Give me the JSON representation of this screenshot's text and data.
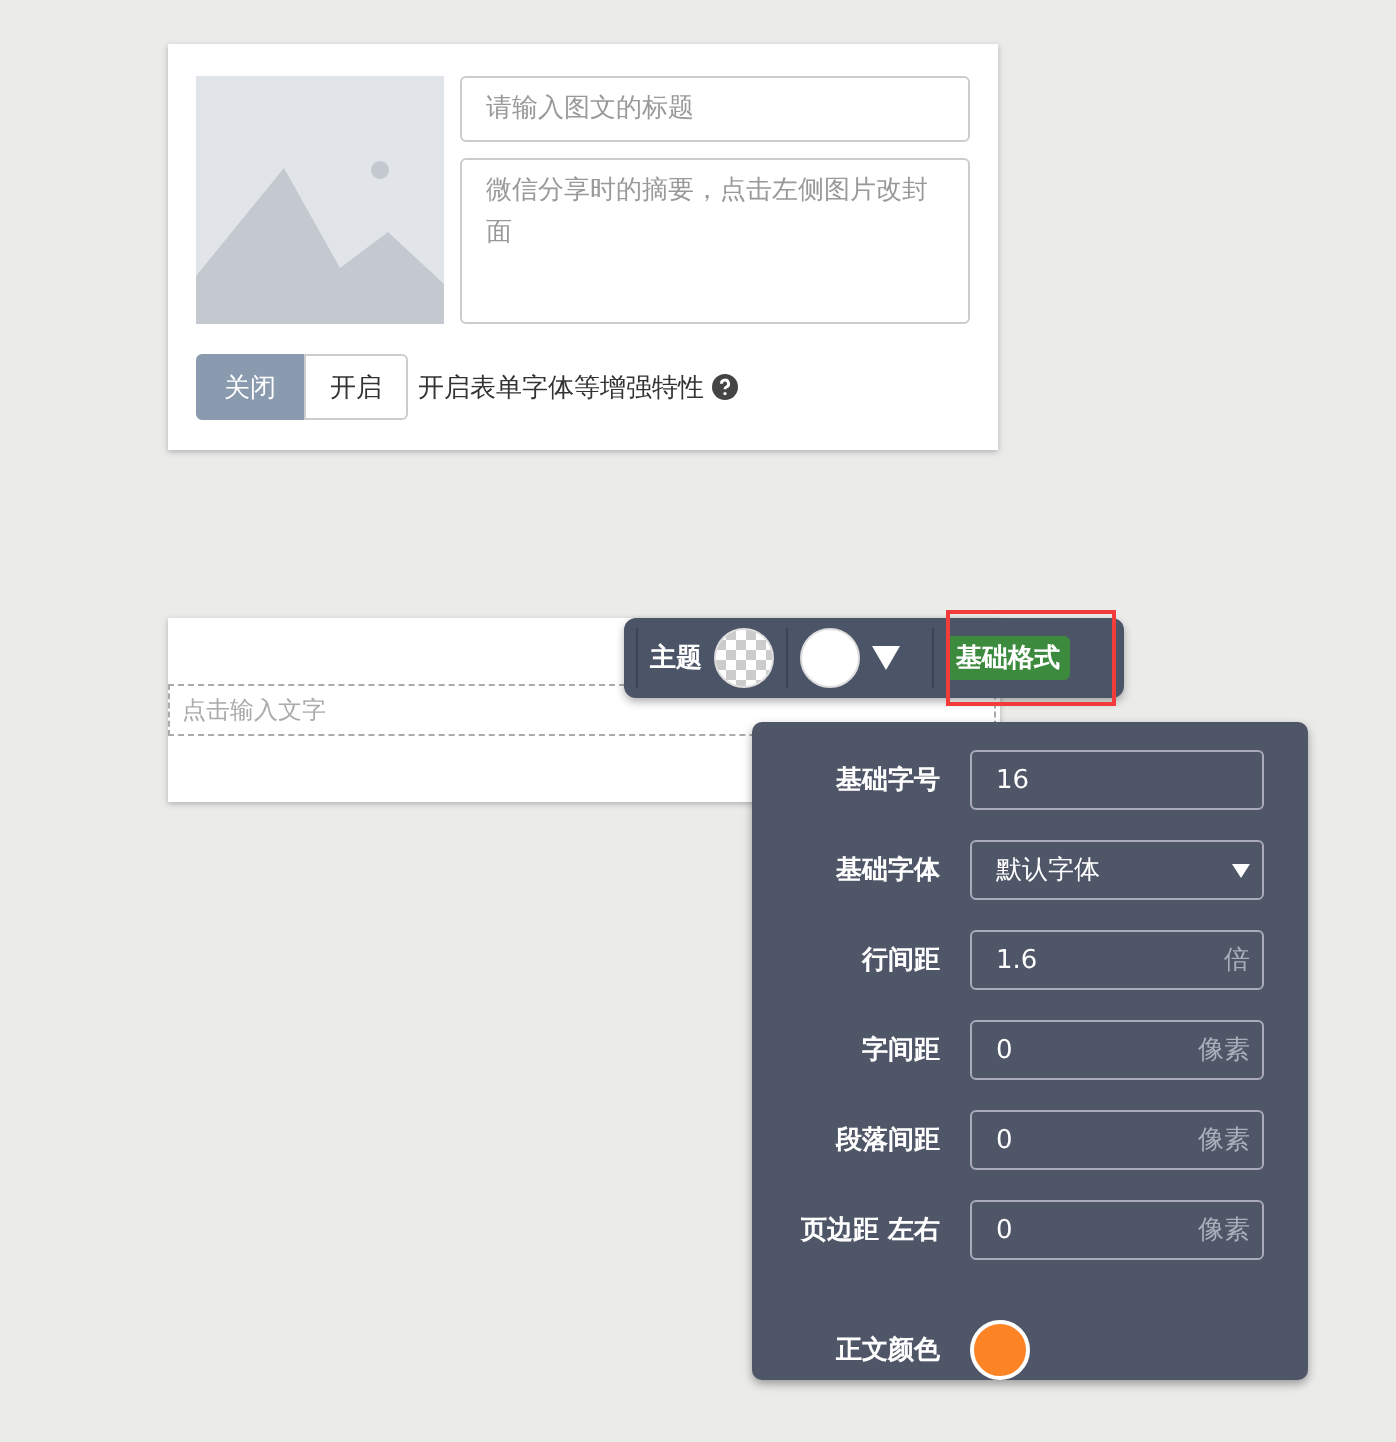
{
  "cover_card": {
    "title_field": {
      "placeholder": "请输入图文的标题"
    },
    "summary_field": {
      "placeholder": "微信分享时的摘要，点击左侧图片改封面"
    },
    "toggle": [
      {
        "label": "关闭",
        "selected": true
      },
      {
        "label": "开启",
        "selected": false
      }
    ],
    "toggle_hint": "开启表单字体等增强特性"
  },
  "editor_card": {
    "text_field": {
      "placeholder": "点击输入文字"
    }
  },
  "toolbar": {
    "theme_label": "主题",
    "format_button": {
      "label": "基础格式",
      "selected": true,
      "highlighted": true
    }
  },
  "format_panel": {
    "rows": [
      {
        "label": "基础字号",
        "kind": "input",
        "value": "16"
      },
      {
        "label": "基础字体",
        "kind": "select",
        "value": "默认字体"
      },
      {
        "label": "行间距",
        "kind": "input",
        "value": "1.6",
        "unit": "倍"
      },
      {
        "label": "字间距",
        "kind": "input",
        "value": "0",
        "unit": "像素"
      },
      {
        "label": "段落间距",
        "kind": "input",
        "value": "0",
        "unit": "像素"
      },
      {
        "label": "页边距 左右",
        "kind": "input",
        "value": "0",
        "unit": "像素"
      },
      {
        "label": "正文颜色",
        "kind": "color",
        "color": "#fd8424"
      }
    ]
  }
}
